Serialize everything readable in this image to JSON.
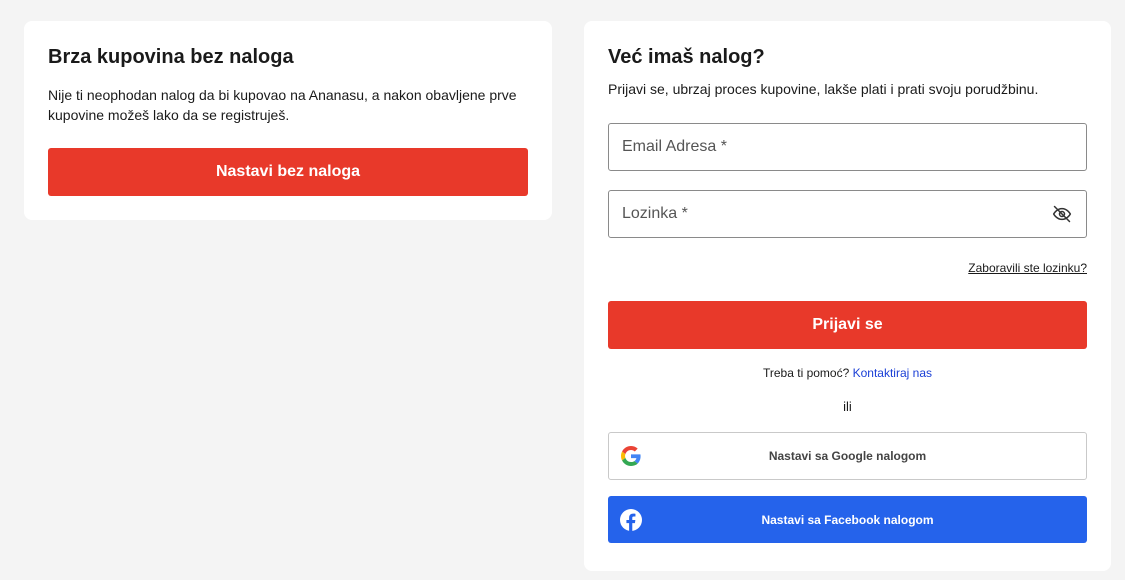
{
  "guest": {
    "title": "Brza kupovina bez naloga",
    "description": "Nije ti neophodan nalog da bi kupovao na Ananasu, a nakon obavljene prve kupovine možeš lako da se registruješ.",
    "button_label": "Nastavi bez naloga"
  },
  "login": {
    "title": "Već imaš nalog?",
    "description": "Prijavi se, ubrzaj proces kupovine, lakše plati i prati svoju porudžbinu.",
    "email_placeholder": "Email Adresa *",
    "password_placeholder": "Lozinka *",
    "password_toggle_icon": "eye-off-icon",
    "forgot_label": "Zaboravili ste lozinku?",
    "submit_label": "Prijavi se",
    "help_text": "Treba ti pomoć?",
    "help_link": "Kontaktiraj nas",
    "or_label": "ili",
    "google_label": "Nastavi sa Google nalogom",
    "google_icon": "google-icon",
    "facebook_label": "Nastavi sa Facebook nalogom",
    "facebook_icon": "facebook-icon"
  },
  "colors": {
    "accent_red": "#e8392a",
    "facebook_blue": "#2563eb",
    "link_blue": "#1a3fd6",
    "page_background": "#f4f4f4"
  }
}
